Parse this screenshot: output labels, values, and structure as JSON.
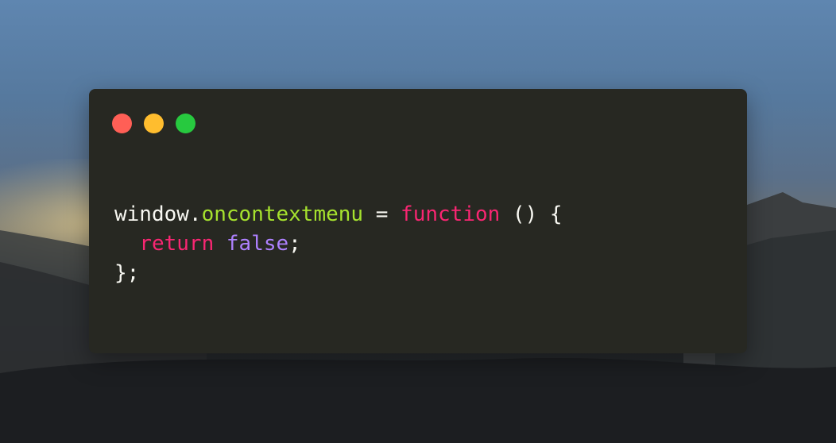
{
  "colors": {
    "editor_background": "#272822",
    "close_button": "#ff5f56",
    "minimize_button": "#ffbd2e",
    "maximize_button": "#27c93f",
    "plain_text": "#f8f8f2",
    "property": "#a6e22e",
    "keyword": "#f92672",
    "constant": "#ae81ff"
  },
  "window_controls": {
    "close": "close-dot-icon",
    "minimize": "minimize-dot-icon",
    "maximize": "maximize-dot-icon"
  },
  "code": {
    "line1": {
      "object": "window",
      "dot": ".",
      "property": "oncontextmenu",
      "assign": " = ",
      "keyword": "function",
      "rest": " () {"
    },
    "line2": {
      "indent": "  ",
      "keyword": "return",
      "space": " ",
      "value": "false",
      "end": ";"
    },
    "line3": {
      "text": "};"
    }
  }
}
